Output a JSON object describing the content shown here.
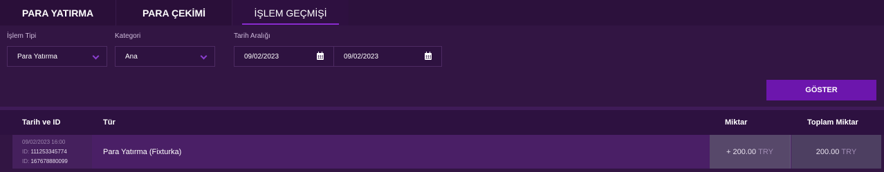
{
  "tabs": [
    {
      "label": "PARA YATIRMA"
    },
    {
      "label": "PARA ÇEKİMİ"
    },
    {
      "label": "İŞLEM GEÇMİŞİ",
      "active": true
    }
  ],
  "filters": {
    "transaction_type": {
      "label": "İşlem Tipi",
      "value": "Para Yatırma"
    },
    "category": {
      "label": "Kategori",
      "value": "Ana"
    },
    "date_range": {
      "label": "Tarih Aralığı",
      "from": "09/02/2023",
      "to": "09/02/2023"
    }
  },
  "show_button": "GÖSTER",
  "table": {
    "headers": {
      "date_id": "Tarih ve ID",
      "type": "Tür",
      "amount": "Miktar",
      "total": "Toplam Miktar"
    },
    "rows": [
      {
        "datetime": "09/02/2023 16:00",
        "id1_prefix": "ID:",
        "id1": "111253345774",
        "id2_prefix": "ID:",
        "id2": "167678880099",
        "type": "Para Yatırma (Fixturka)",
        "amount": "+ 200.00",
        "amount_currency": "TRY",
        "total": "200.00",
        "total_currency": "TRY"
      }
    ]
  },
  "colors": {
    "background": "#321543",
    "accent": "#6c16ad",
    "tab_underline": "#8a2bd0"
  },
  "icons": {
    "dropdown": "chevron-down-icon",
    "date": "calendar-icon"
  }
}
